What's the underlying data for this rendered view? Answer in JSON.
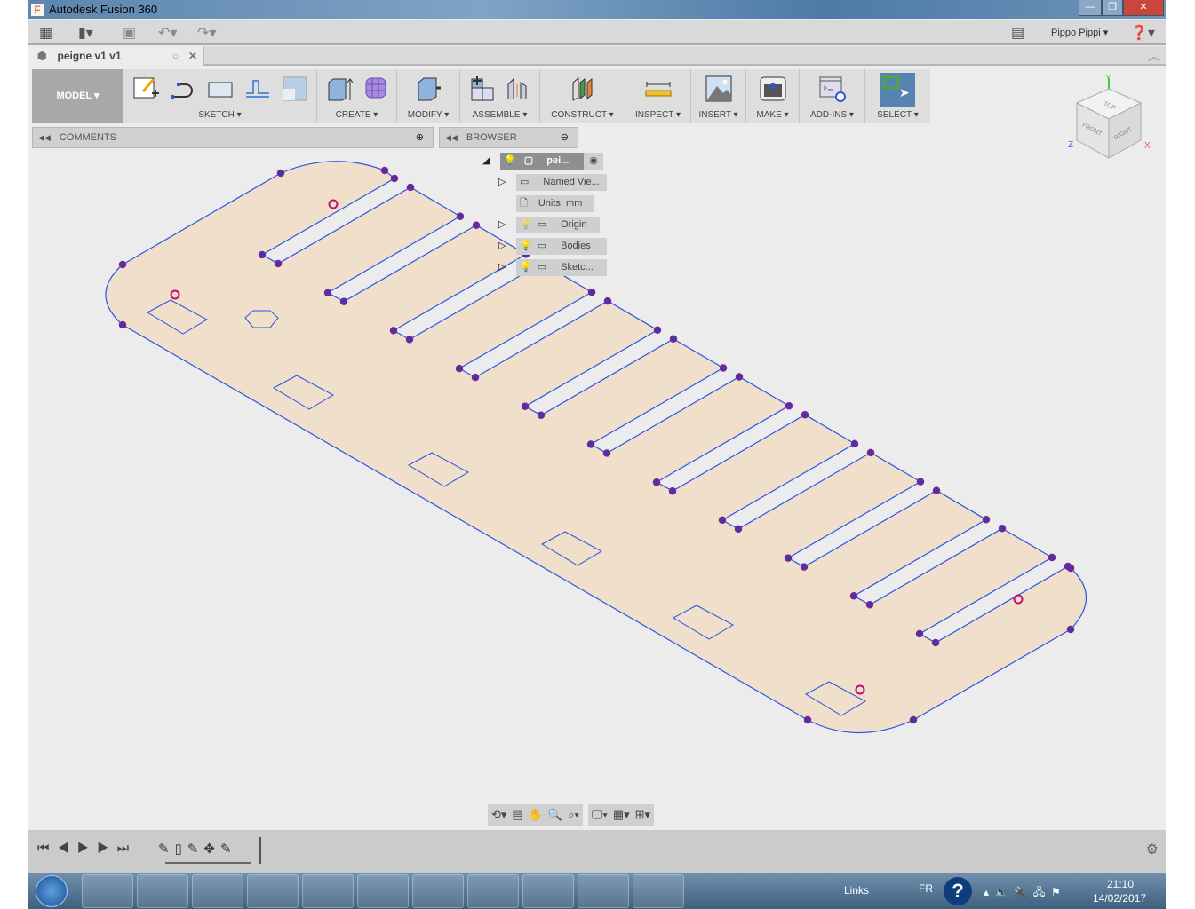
{
  "window": {
    "title": "Autodesk Fusion 360",
    "minimize": "—",
    "restore": "❐",
    "close": "✕"
  },
  "quickbar": {
    "user": "Pippo Pippi",
    "icons": [
      "apps-grid-icon",
      "file-icon",
      "save-icon",
      "undo-icon",
      "redo-icon",
      "comment-icon",
      "help-icon"
    ]
  },
  "document_tab": {
    "name": "peigne v1 v1"
  },
  "ribbon": {
    "workspace": "MODEL",
    "groups": [
      {
        "label": "SKETCH"
      },
      {
        "label": "CREATE"
      },
      {
        "label": "MODIFY"
      },
      {
        "label": "ASSEMBLE"
      },
      {
        "label": "CONSTRUCT"
      },
      {
        "label": "INSPECT"
      },
      {
        "label": "INSERT"
      },
      {
        "label": "MAKE"
      },
      {
        "label": "ADD-INS"
      },
      {
        "label": "SELECT"
      }
    ]
  },
  "panels": {
    "comments": "COMMENTS",
    "browser": "BROWSER"
  },
  "browser_tree": {
    "root": "pei...",
    "items": [
      "Named Vie...",
      "Units: mm",
      "Origin",
      "Bodies",
      "Sketc..."
    ]
  },
  "viewcube": {
    "top": "TOP",
    "front": "FRONT",
    "right": "RIGHT",
    "x": "X",
    "y": "Y",
    "z": "Z"
  },
  "sketch_colors": {
    "fill": "#f0dfcb",
    "line": "#2a55e6",
    "point": "#8a1f8a"
  },
  "taskbar": {
    "links": "Links",
    "lang": "FR",
    "time": "21:10",
    "date": "14/02/2017",
    "apps": [
      "windows-start",
      "internet-explorer",
      "file-explorer",
      "media-player",
      "chrome",
      "inkscape-rhino",
      "git",
      "atom",
      "winrar",
      "inkscape",
      "gimp",
      "fusion-360"
    ]
  }
}
